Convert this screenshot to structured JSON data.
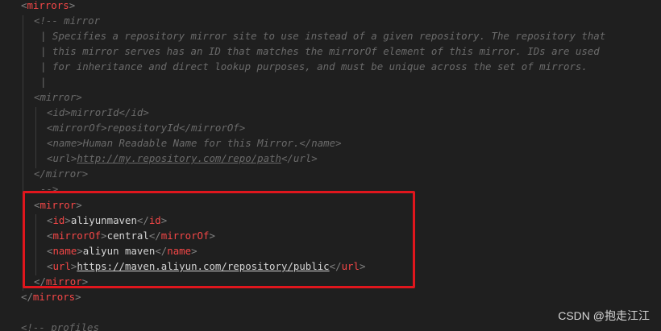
{
  "theme": {
    "background": "#1f1f1f",
    "tag_color": "#f44747",
    "bracket_color": "#808080",
    "text_color": "#d4d4d4",
    "comment_color": "#6a6a6a",
    "highlight_border": "#e0161d"
  },
  "code": {
    "mirrors_open": "mirrors",
    "comment_open": "<!-- mirror",
    "comment_desc_1": "| Specifies a repository mirror site to use instead of a given repository. The repository that",
    "comment_desc_2": "| this mirror serves has an ID that matches the mirrorOf element of this mirror. IDs are used",
    "comment_desc_3": "| for inheritance and direct lookup purposes, and must be unique across the set of mirrors.",
    "comment_pipe": "|",
    "example": {
      "mirror_tag": "mirror",
      "id_tag": "id",
      "id_value": "mirrorId",
      "mirrorof_tag": "mirrorOf",
      "mirrorof_value": "repositoryId",
      "name_tag": "name",
      "name_value": "Human Readable Name for this Mirror.",
      "url_tag": "url",
      "url_value": "http://my.repository.com/repo/path"
    },
    "comment_close": "-->",
    "active": {
      "mirror_tag": "mirror",
      "id_tag": "id",
      "id_value": "aliyunmaven",
      "mirrorof_tag": "mirrorOf",
      "mirrorof_value": "central",
      "name_tag": "name",
      "name_value": "aliyun maven",
      "url_tag": "url",
      "url_value": "https://maven.aliyun.com/repository/public"
    },
    "mirrors_close": "mirrors",
    "profiles_comment": "<!-- profiles"
  },
  "watermark": "CSDN @抱走江江"
}
